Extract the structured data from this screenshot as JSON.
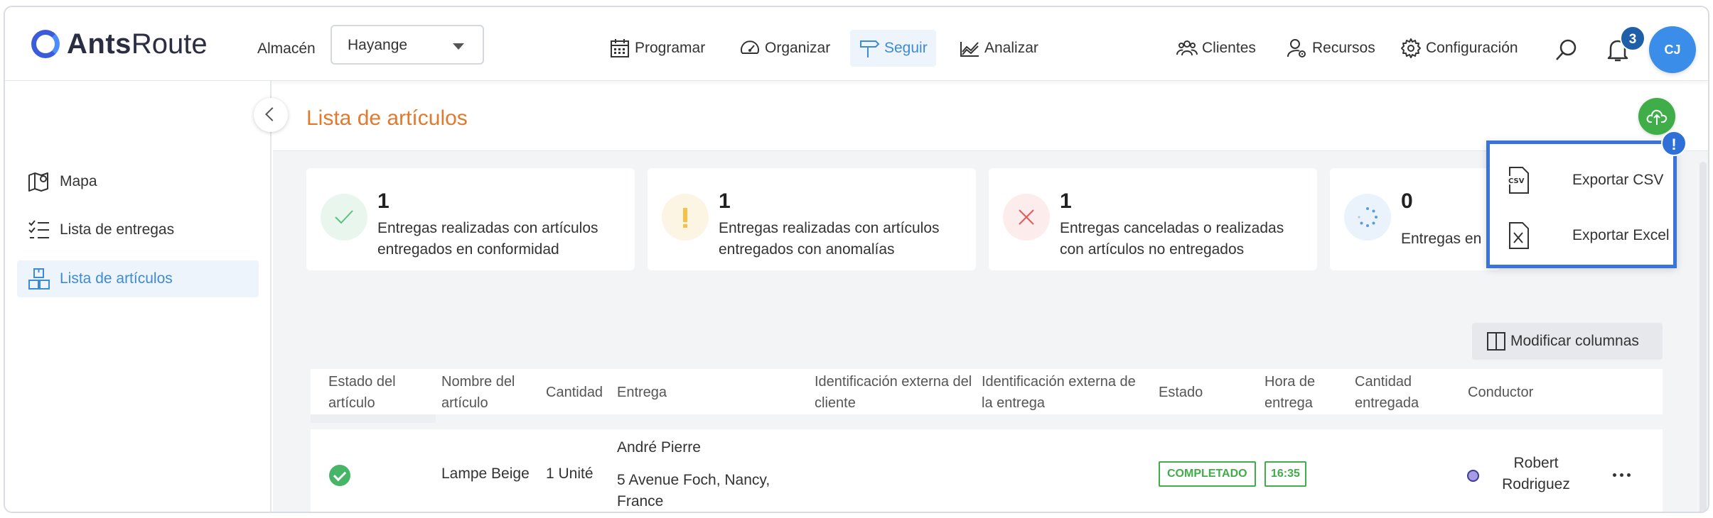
{
  "header": {
    "logo_bold": "Ants",
    "logo_regular": "Route",
    "warehouse_label": "Almacén",
    "warehouse_value": "Hayange",
    "nav": [
      {
        "label": "Programar",
        "icon": "calendar-icon"
      },
      {
        "label": "Organizar",
        "icon": "gauge-icon"
      },
      {
        "label": "Seguir",
        "icon": "signpost-icon",
        "active": true
      },
      {
        "label": "Analizar",
        "icon": "chart-icon"
      }
    ],
    "right_nav": [
      {
        "label": "Clientes",
        "icon": "clients-icon"
      },
      {
        "label": "Recursos",
        "icon": "resources-icon"
      },
      {
        "label": "Configuración",
        "icon": "gear-icon"
      }
    ],
    "notification_count": "3",
    "avatar_initials": "CJ"
  },
  "sidebar": {
    "items": [
      {
        "label": "Mapa",
        "icon": "map-icon"
      },
      {
        "label": "Lista de entregas",
        "icon": "checklist-icon"
      },
      {
        "label": "Lista de artículos",
        "icon": "boxes-icon",
        "active": true
      }
    ]
  },
  "main": {
    "title": "Lista de artículos",
    "cards": [
      {
        "count": "1",
        "desc": "Entregas realizadas con artículos entregados en conformidad",
        "status": "success"
      },
      {
        "count": "1",
        "desc": "Entregas realizadas con artículos entregados con anomalías",
        "status": "warning"
      },
      {
        "count": "1",
        "desc": "Entregas canceladas o realizadas con artículos no entregados",
        "status": "error"
      },
      {
        "count": "0",
        "desc": "Entregas en",
        "status": "pending"
      }
    ],
    "modify_columns_label": "Modificar columnas",
    "table": {
      "headers": [
        "Estado del artículo",
        "Nombre del artículo",
        "Cantidad",
        "Entrega",
        "Identificación externa del cliente",
        "Identificación externa de la entrega",
        "Estado",
        "Hora de entrega",
        "Cantidad entregada",
        "Conductor"
      ],
      "rows": [
        {
          "item_name": "Lampe Beige",
          "quantity": "1 Unité",
          "delivery_name": "André Pierre",
          "delivery_address": "5 Avenue Foch, Nancy, France",
          "status": "COMPLETADO",
          "time": "16:35",
          "driver": "Robert Rodriguez"
        }
      ]
    }
  },
  "export_menu": {
    "items": [
      {
        "label": "Exportar CSV",
        "icon": "csv-file-icon"
      },
      {
        "label": "Exportar Excel",
        "icon": "excel-file-icon"
      }
    ],
    "alert_badge": "!"
  },
  "colors": {
    "accent": "#3d8bd4",
    "title": "#e07a2e",
    "success": "#3fae49",
    "popup_border": "#3b74d8"
  }
}
